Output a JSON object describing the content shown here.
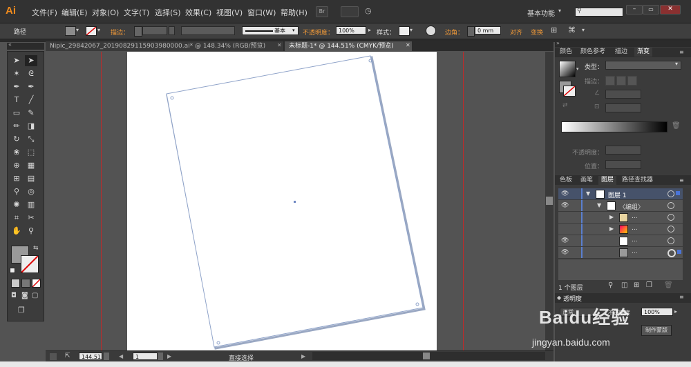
{
  "app": {
    "logo": "Ai"
  },
  "menu": [
    "文件(F)",
    "编辑(E)",
    "对象(O)",
    "文字(T)",
    "选择(S)",
    "效果(C)",
    "视图(V)",
    "窗口(W)",
    "帮助(H)"
  ],
  "toolbar_right": {
    "br_label": "Br",
    "workspace": "基本功能",
    "search_placeholder": ""
  },
  "control": {
    "path": "路径",
    "stroke_label": "描边：",
    "stroke_style": "基本",
    "opacity_label": "不透明度：",
    "opacity_value": "100%",
    "style_label": "样式：",
    "corner_label": "边角：",
    "corner_value": "0 mm",
    "align_label": "对齐",
    "transform_label": "变换"
  },
  "tabs": [
    {
      "label": "Nipic_29842067_20190829115903980000.ai* @ 148.34% (RGB/预览)",
      "active": false
    },
    {
      "label": "未标题-1* @ 144.51% (CMYK/预览)",
      "active": true
    }
  ],
  "panel_top": {
    "tabs": [
      "颜色",
      "颜色参考",
      "描边",
      "渐变"
    ],
    "type_label": "类型：",
    "stroke_label": "描边：",
    "opacity_label": "不透明度：",
    "position_label": "位置："
  },
  "panel_layers": {
    "tabs": [
      "色板",
      "画笔",
      "图层",
      "路径查找器"
    ],
    "rows": [
      {
        "name": "图层 1",
        "indent": 0,
        "eye": true
      },
      {
        "name": "〈编组〉",
        "indent": 1,
        "eye": true
      },
      {
        "name": "...",
        "indent": 2,
        "eye": false
      },
      {
        "name": "...",
        "indent": 2,
        "eye": false
      },
      {
        "name": "...",
        "indent": 2,
        "eye": true
      },
      {
        "name": "...",
        "indent": 2,
        "eye": true
      }
    ],
    "footer": "1 个图层"
  },
  "panel_transparency": {
    "title": "透明度",
    "mode": "正常",
    "opacity_label": "不透明度",
    "opacity_value": "100%",
    "mask_btn": "制作蒙版"
  },
  "status": {
    "zoom": "144.51",
    "page": "1",
    "mode": "直接选择"
  },
  "watermark": {
    "brand": "Baidu经验",
    "url": "jingyan.baidu.com"
  },
  "colors": {
    "accent": "#f08b1d",
    "path": "#8fa3c9",
    "guide": "#c02a2a"
  }
}
